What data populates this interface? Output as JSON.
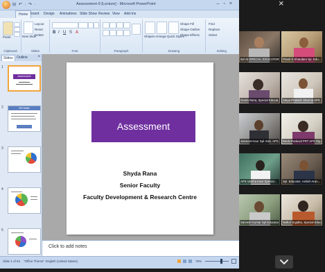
{
  "app": {
    "window_title": "Assessment-9 [Lecture] - Microsoft PowerPoint",
    "quick_access": "⊟ ↶ · ↷ ·",
    "window_controls": [
      "–",
      "▫",
      "×"
    ]
  },
  "ribbon": {
    "tabs": [
      "Home",
      "Insert",
      "Design",
      "Animations",
      "Slide Show",
      "Review",
      "View",
      "Add-Ins"
    ],
    "groups": [
      "Clipboard",
      "Slides",
      "Font",
      "Paragraph",
      "Drawing",
      "Editing"
    ],
    "items": {
      "paste": "Paste",
      "new_slide": "New Slide",
      "layout": "Layout",
      "reset": "Reset",
      "delete": "Delete",
      "shapes": "Shapes",
      "arrange": "Arrange",
      "quick_styles": "Quick Styles",
      "shape_fill": "Shape Fill",
      "shape_outline": "Shape Outline",
      "shape_effects": "Shape Effects",
      "find": "Find",
      "replace": "Replace",
      "select": "Select"
    }
  },
  "slides_panel": {
    "tabs": [
      "Slides",
      "Outline"
    ],
    "numbers": [
      "1",
      "2",
      "3",
      "4",
      "5"
    ],
    "thumb1_title": "Assessment",
    "thumb2_title": "Self Health"
  },
  "slide": {
    "title": "Assessment",
    "presenter_name": "Shyda Rana",
    "presenter_role": "Senior Faculty",
    "presenter_org": "Faculty Development & Research Centre",
    "banner_color": "#6f2f9f"
  },
  "notes": {
    "placeholder": "Click to add notes"
  },
  "status_bar": {
    "slide_count": "Slide 1 of 54",
    "theme": "\"Office Theme\"",
    "language": "English (United States)",
    "zoom": "78%"
  },
  "meeting": {
    "participants": [
      {
        "name": "Ilaf Ali SPECIAL EDUCATOR..."
      },
      {
        "name": "Preeti S Khandare Sp. Edu..."
      },
      {
        "name": "Geeta Rana, Special Educat..."
      },
      {
        "name": "Satya Prakash Sharma APS ..."
      },
      {
        "name": "Jasmeet Kaur Spl. Edu. APS..."
      },
      {
        "name": "Bindu Poduval PRT APS Dig..."
      },
      {
        "name": "APS Varsha Kaur Special..."
      },
      {
        "name": "Spl. Educator, Ashish Aran..."
      },
      {
        "name": "Sarvesh Kumar Spl Educator..."
      },
      {
        "name": "Nalluri Sujatha, Special Educat..."
      }
    ]
  }
}
